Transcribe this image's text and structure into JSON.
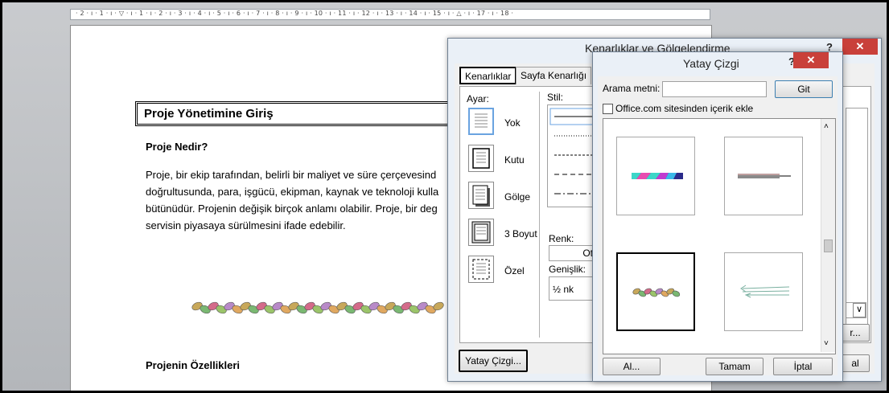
{
  "ruler": {
    "ticks": "· 2 · ı · 1 · ı · ▽ · ı · 1 · ı · 2 · ı · 3 · ı · 4 · ı · 5 · ı · 6 · ı · 7 · ı · 8 · ı · 9 · ı · 10 · ı · 11 · ı · 12 · ı · 13 · ı · 14 · ı · 15 · ı · △ · ı · 17 · ı · 18 ·"
  },
  "document": {
    "heading": "Proje Yönetimine Giriş",
    "section1": "Proje Nedir?",
    "paragraph_lines": [
      "Proje, bir ekip tarafından, belirli bir maliyet ve süre çerçevesind",
      "doğrultusunda, para, işgücü, ekipman, kaynak ve teknoloji kulla",
      "bütünüdür. Projenin değişik birçok anlamı olabilir.  Proje, bir deg",
      "servisin piyasaya sürülmesini ifade edebilir."
    ],
    "section2": "Projenin Özellikleri"
  },
  "borders_dialog": {
    "title": "Kenarlıklar ve Gölgelendirme",
    "help": "?",
    "close": "✕",
    "tabs": [
      "Kenarlıklar",
      "Sayfa Kenarlığı"
    ],
    "setting_label": "Ayar:",
    "settings": [
      "Yok",
      "Kutu",
      "Gölge",
      "3 Boyut",
      "Özel"
    ],
    "style_label": "Stil:",
    "color_label": "Renk:",
    "color_value": "Ot",
    "width_label": "Genişlik:",
    "width_value": "½ nk",
    "horizontal_line_button": "Yatay Çizgi...",
    "right_dropdown_arrow": "∨",
    "right_options_button": "r...",
    "right_cancel_button": "al"
  },
  "hline_dialog": {
    "title": "Yatay Çizgi",
    "help": "?",
    "close": "✕",
    "search_label": "Arama metni:",
    "search_value": "",
    "go_button": "Git",
    "office_checkbox_label": "Office.com sitesinden içerik ekle",
    "office_checked": false,
    "import_button": "Al...",
    "ok_button": "Tamam",
    "cancel_button": "İptal"
  }
}
